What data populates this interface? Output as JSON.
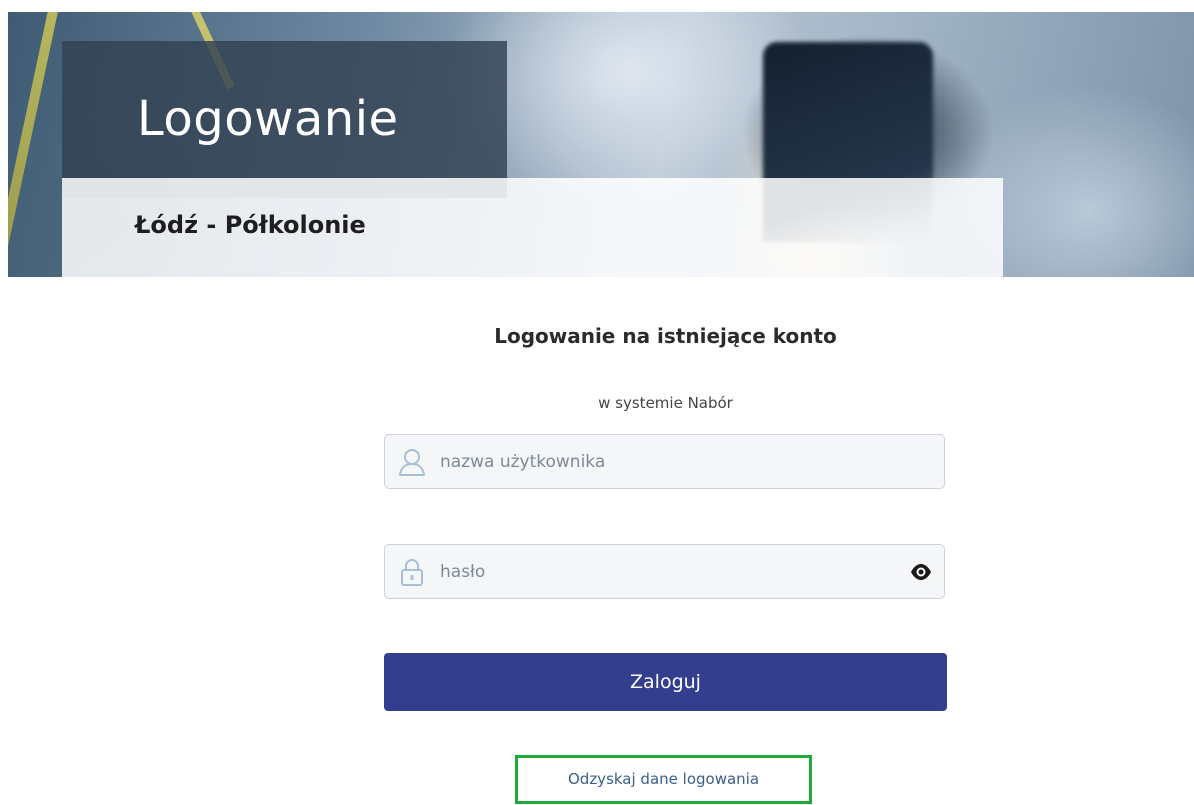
{
  "header": {
    "title": "Logowanie",
    "subtitle": "Łódź - Półkolonie"
  },
  "form": {
    "heading": "Logowanie na istniejące konto",
    "subheading": "w systemie Nabór",
    "username": {
      "placeholder": "nazwa użytkownika",
      "value": "",
      "icon": "user-icon"
    },
    "password": {
      "placeholder": "hasło",
      "value": "",
      "icon": "lock-icon",
      "toggle_icon": "eye-icon"
    },
    "submit_label": "Zaloguj",
    "recover_link": "Odzyskaj dane logowania"
  },
  "colors": {
    "primary_button": "#343e8f",
    "highlight_border": "#1faa3a",
    "link": "#3a5f8a"
  }
}
